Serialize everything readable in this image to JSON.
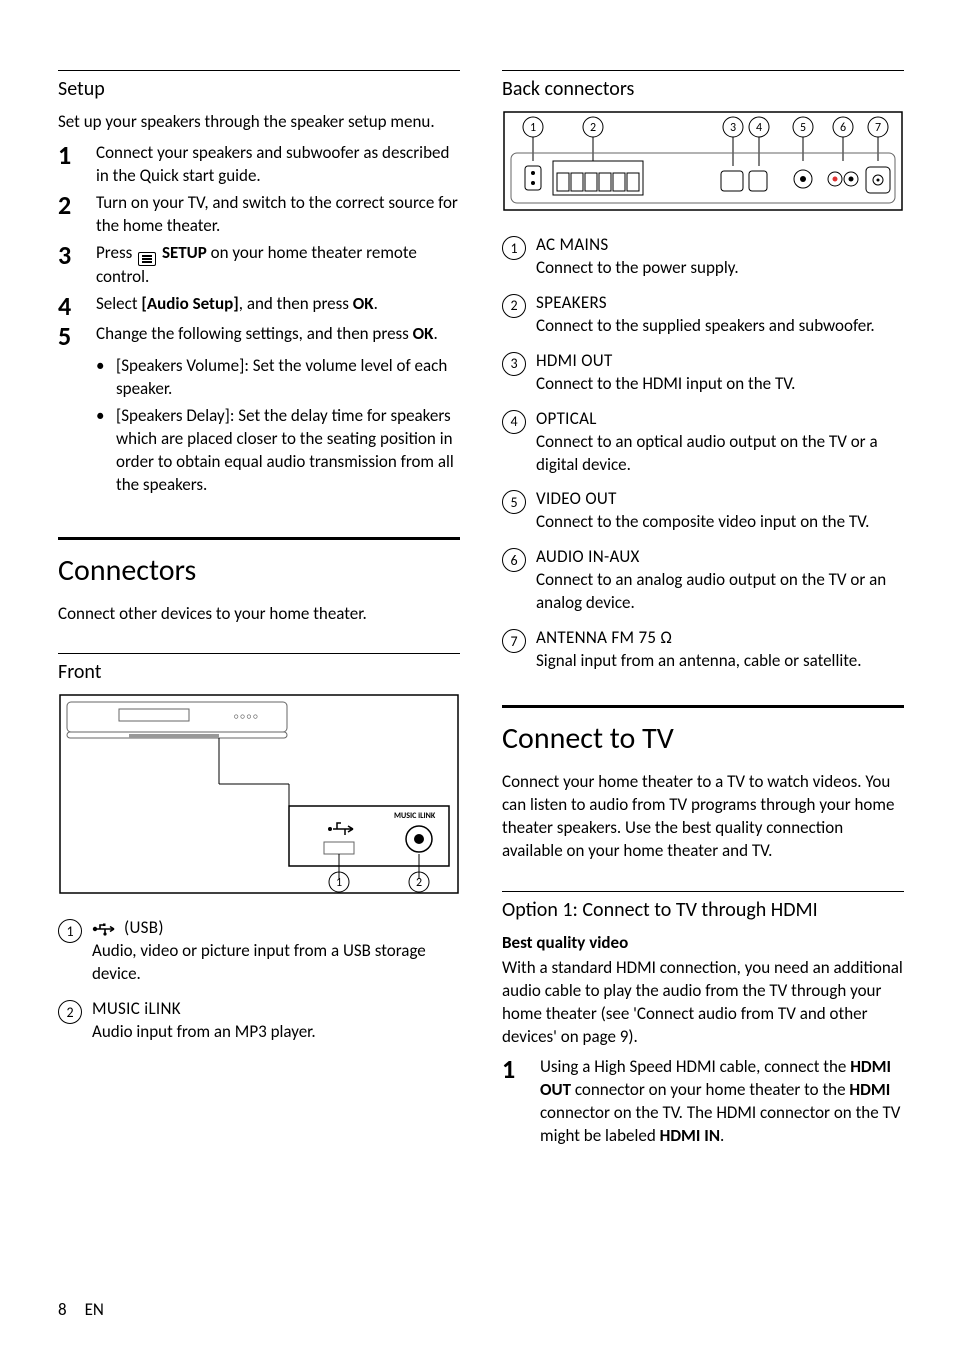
{
  "left": {
    "setup_h": "Setup",
    "setup_p": "Set up your speakers through the speaker setup menu.",
    "steps": [
      "Connect your speakers and subwoofer as described in the Quick start guide.",
      "Turn on your TV, and switch to the correct source for the home theater.",
      "Press |SETUPICON| |B|SETUP|/B| on your home theater remote control.",
      "Select |B|[Audio Setup]|/B|, and then press |B|OK|/B|.",
      "Change the following settings, and then press |B|OK|/B|."
    ],
    "substeps": [
      "|B|[Speakers Volume]|/B|: Set the volume level of each speaker.",
      "|B|[Speakers Delay]|/B|: Set the delay time for speakers which are placed closer to the seating position in order to obtain equal audio transmission from all the speakers."
    ],
    "connectors_h": "Connectors",
    "connectors_p": "Connect other devices to your home theater.",
    "front_h": "Front",
    "front_defs": [
      {
        "n": "1",
        "title": "|USBICON| (USB)",
        "desc": "Audio, video or picture input from a USB storage device."
      },
      {
        "n": "2",
        "title": "MUSIC iLINK",
        "desc": "Audio input from an MP3 player."
      }
    ]
  },
  "right": {
    "back_h": "Back connectors",
    "back_defs": [
      {
        "n": "1",
        "title": "AC MAINS",
        "desc": "Connect to the power supply."
      },
      {
        "n": "2",
        "title": "SPEAKERS",
        "desc": "Connect to the supplied speakers and subwoofer."
      },
      {
        "n": "3",
        "title": "HDMI OUT",
        "desc": "Connect to the HDMI input on the TV."
      },
      {
        "n": "4",
        "title": "OPTICAL",
        "desc": "Connect to an optical audio output on the TV or a digital device."
      },
      {
        "n": "5",
        "title": "VIDEO OUT",
        "desc": "Connect to the composite video input on the TV."
      },
      {
        "n": "6",
        "title": "AUDIO IN-AUX",
        "desc": "Connect to an analog audio output on the TV or an analog device."
      },
      {
        "n": "7",
        "title": "ANTENNA FM 75 Ω",
        "desc": "Signal input from an antenna, cable or satellite."
      }
    ],
    "connecttv_h": "Connect to TV",
    "connecttv_p": "Connect your home theater to a TV to watch videos. You can listen to audio from TV programs through your home theater speakers. Use the best quality connection available on your home theater and TV.",
    "opt1_h": "Option 1: Connect to TV through HDMI",
    "opt1_sub": "Best quality video",
    "opt1_p": "With a standard HDMI connection, you need an additional audio cable to play the audio from the TV through your home theater (see 'Connect audio from TV and other devices' on page 9).",
    "opt1_step1": "Using a High Speed HDMI cable, connect the |B|HDMI OUT|/B| connector on your home theater to the |B|HDMI|/B| connector on the TV. The HDMI connector on the TV might be labeled |B|HDMI IN|/B|."
  },
  "footer": {
    "page": "8",
    "lang": "EN"
  },
  "front_svg_label": "MUSIC iLINK",
  "chart_data": null
}
